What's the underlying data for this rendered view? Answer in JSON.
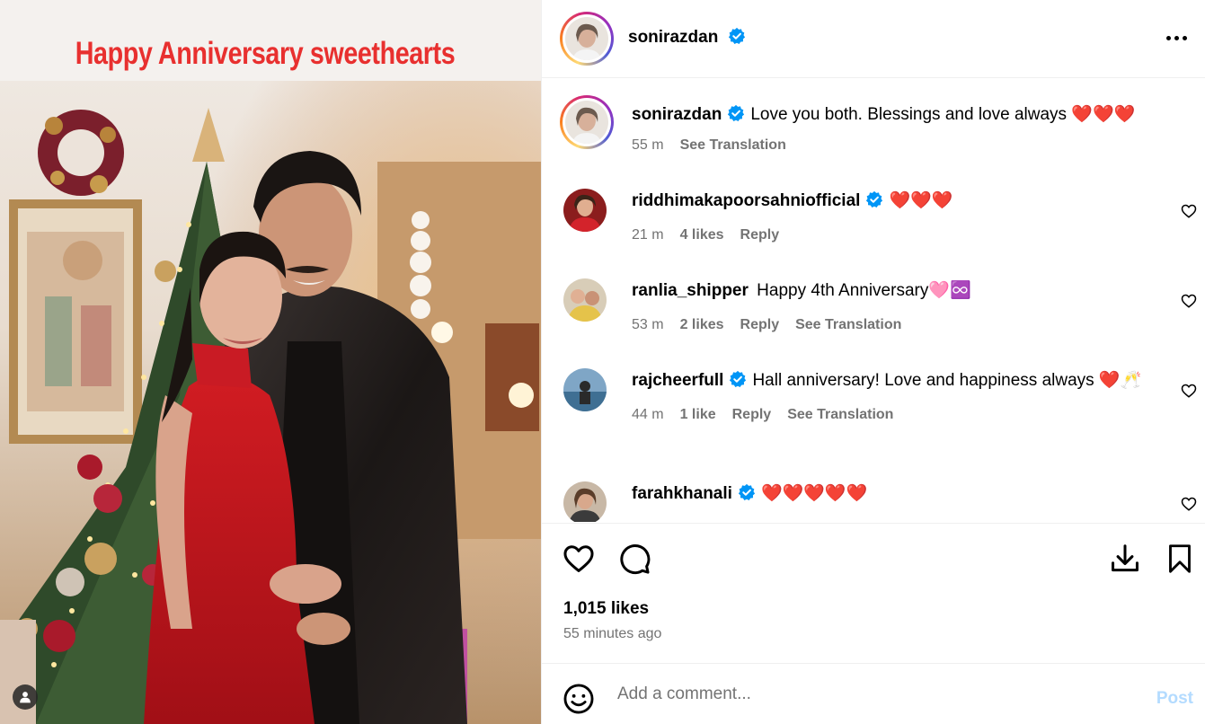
{
  "photo": {
    "overlay_text": "Happy Anniversary sweethearts"
  },
  "post": {
    "author": "sonirazdan",
    "author_verified": true,
    "caption": {
      "username": "sonirazdan",
      "text": "Love you both. Blessings and love always ❤️❤️❤️",
      "time": "55 m",
      "see_translation": "See Translation"
    },
    "comments": [
      {
        "username": "riddhimakapoorsahniofficial",
        "verified": true,
        "text": "❤️❤️❤️",
        "time": "21 m",
        "likes": "4 likes",
        "reply": "Reply"
      },
      {
        "username": "ranlia_shipper",
        "verified": false,
        "text": "Happy 4th Anniversary🩷♾️",
        "time": "53 m",
        "likes": "2 likes",
        "reply": "Reply",
        "see_translation": "See Translation"
      },
      {
        "username": "rajcheerfull",
        "verified": true,
        "text": "Hall anniversary! Love and happiness always ❤️🥂",
        "time": "44 m",
        "likes": "1 like",
        "reply": "Reply",
        "see_translation": "See Translation"
      },
      {
        "username": "farahkhanali",
        "verified": true,
        "text": "❤️❤️❤️❤️❤️"
      }
    ],
    "likes_count": "1,015 likes",
    "posted_ago": "55 minutes ago"
  },
  "add_comment": {
    "placeholder": "Add a comment...",
    "post_label": "Post"
  },
  "icons": {
    "like": "heart-icon",
    "comment": "speech-bubble-icon",
    "save": "bookmark-icon",
    "download": "download-icon",
    "emoji": "smiley-icon",
    "more": "more-options-icon",
    "verified": "verified-badge-icon",
    "tagged_user": "user-icon"
  },
  "colors": {
    "verified_blue": "#0095f6",
    "post_disabled": "#b3dbff",
    "overlay_red": "#e8302f",
    "secondary_text": "#737373"
  }
}
